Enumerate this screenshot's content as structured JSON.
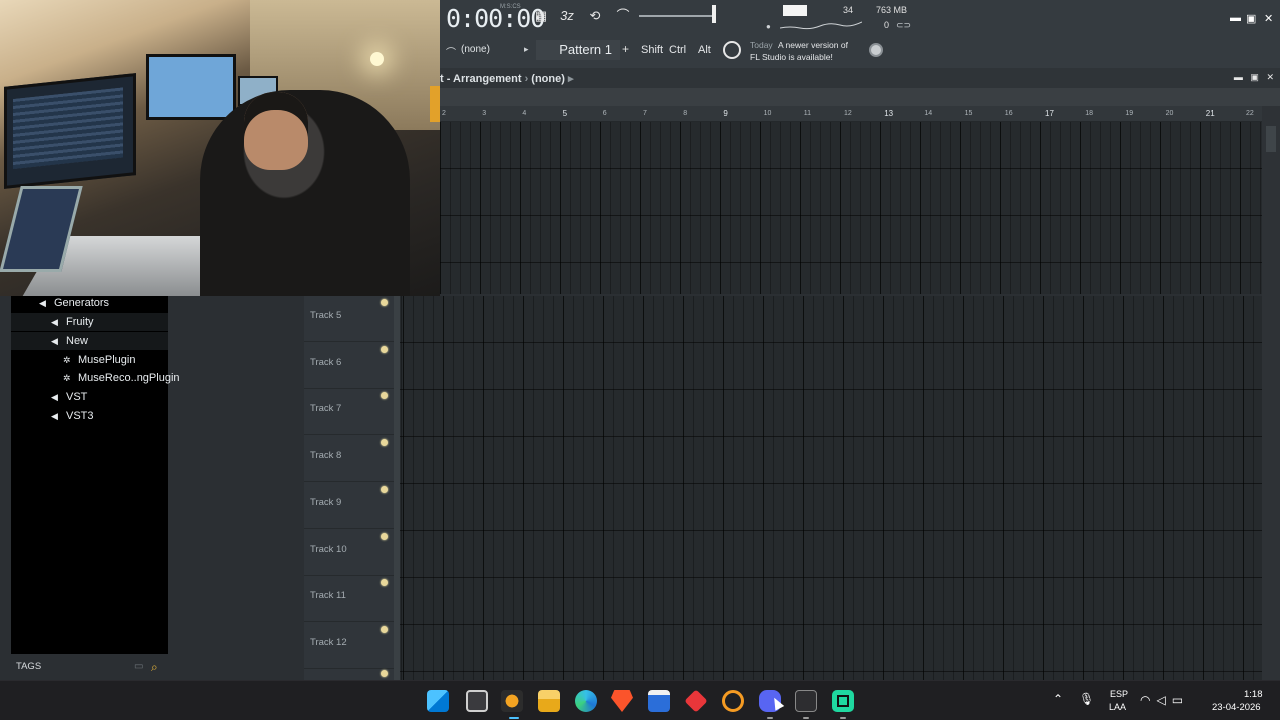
{
  "toolbar": {
    "time_display": "0:00:00",
    "time_unit": "M:S:CS",
    "cpu_value": "34",
    "memory_value": "763 MB",
    "polyphony_value": "0",
    "minimize_icon": "minimize-icon",
    "maximize_icon": "maximize-icon",
    "close_icon": "close-icon"
  },
  "pattern_bar": {
    "channel_selector": "(none)",
    "pattern_name": "Pattern 1",
    "add_label": "+",
    "modifier_keys": [
      "Shift",
      "Ctrl",
      "Alt"
    ],
    "news_date": "Today",
    "news_line1": "A newer version of",
    "news_line2": "FL Studio is available!"
  },
  "playlist": {
    "title": "t - Arrangement",
    "arrangement": "(none)",
    "bar_numbers": [
      "2",
      "3",
      "4",
      "5",
      "6",
      "7",
      "8",
      "9",
      "10",
      "11",
      "12",
      "13",
      "14",
      "15",
      "16",
      "17",
      "18",
      "19",
      "20",
      "21",
      "22"
    ],
    "tracks": [
      "Track 5",
      "Track 6",
      "Track 7",
      "Track 8",
      "Track 9",
      "Track 10",
      "Track 11",
      "Track 12"
    ]
  },
  "browser": {
    "items": [
      {
        "label": "Generators",
        "icon": "speaker-icon"
      },
      {
        "label": "Fruity",
        "icon": "speaker-icon"
      },
      {
        "label": "New",
        "icon": "speaker-icon"
      },
      {
        "label": "MusePlugin",
        "icon": "gear-icon"
      },
      {
        "label": "MuseReco..ngPlugin",
        "icon": "gear-icon"
      },
      {
        "label": "VST",
        "icon": "speaker-icon"
      },
      {
        "label": "VST3",
        "icon": "speaker-icon"
      }
    ],
    "tags_label": "TAGS"
  },
  "taskbar": {
    "apps": [
      "windows-start-icon",
      "task-view-icon",
      "fl-studio-icon",
      "file-explorer-icon",
      "edge-icon",
      "brave-icon",
      "store-icon",
      "git-icon",
      "search-app-icon",
      "discord-icon",
      "recorder-icon",
      "app-icon"
    ],
    "lang_top": "ESP",
    "lang_bottom": "LAA",
    "clock_time": "1:18",
    "clock_date": "23-04-2026"
  },
  "colors": {
    "accent": "#e4b43c",
    "led": "#e8d79a",
    "background": "#262a2d"
  }
}
